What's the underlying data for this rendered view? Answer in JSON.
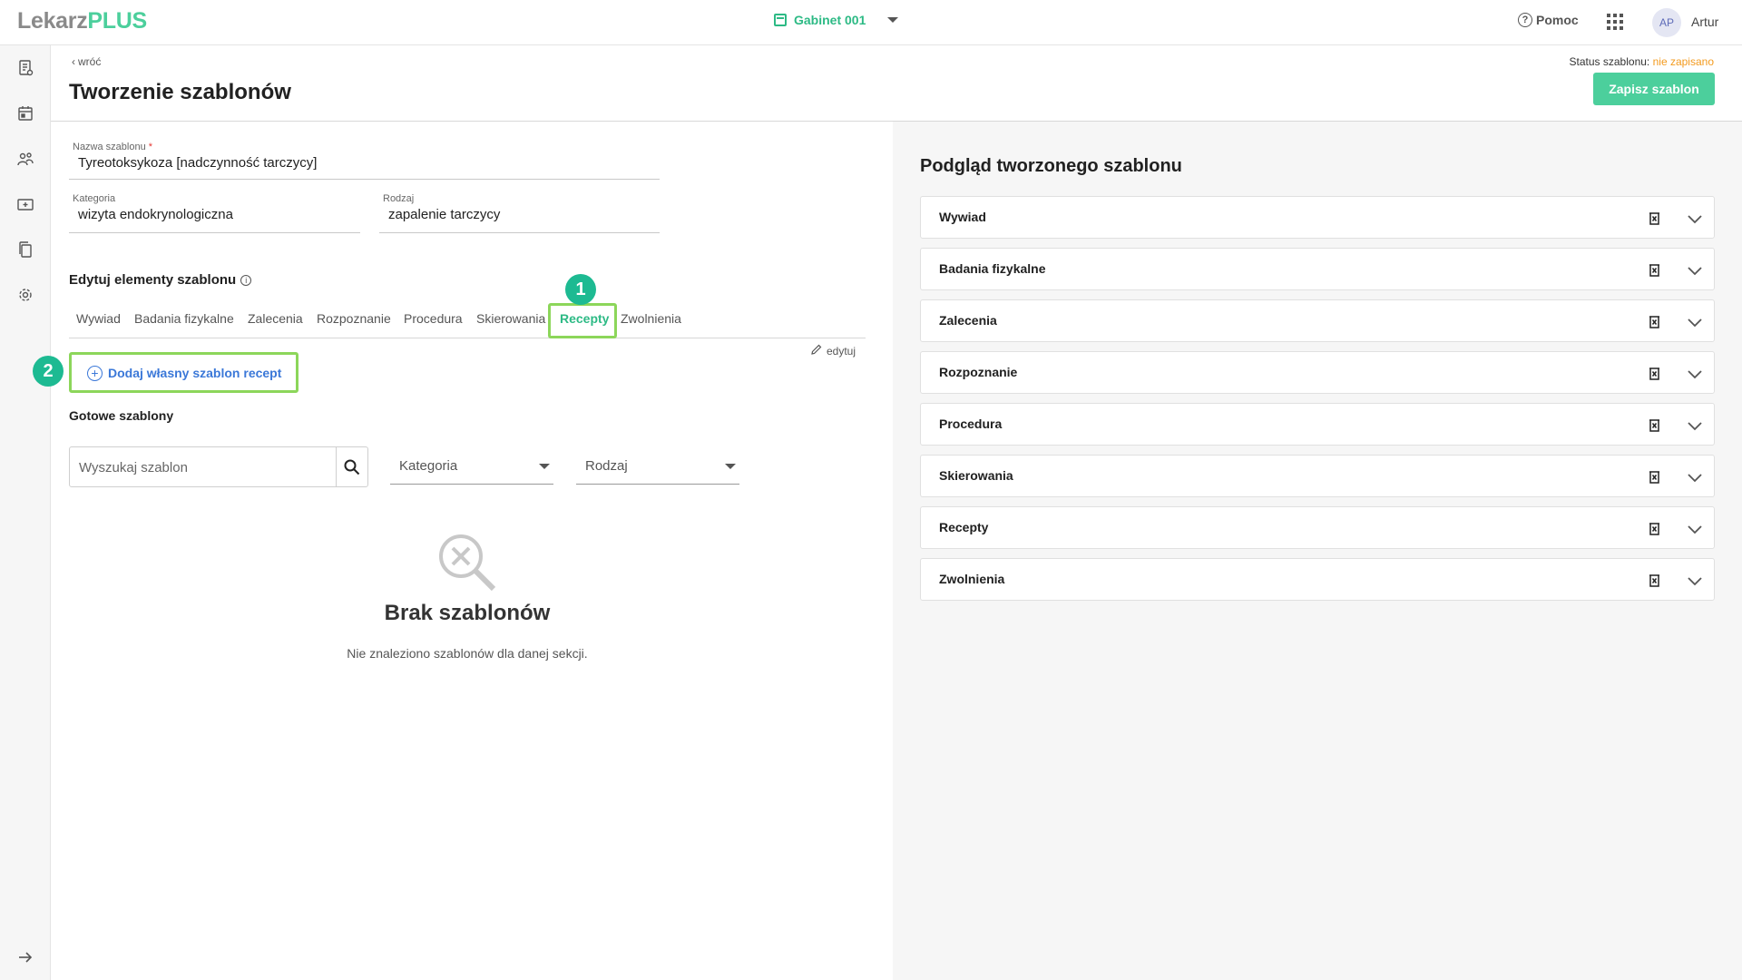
{
  "app": {
    "logo_part1": "Lekarz",
    "logo_part2": "PLUS"
  },
  "topbar": {
    "gabinet": "Gabinet 001",
    "help": "Pomoc",
    "avatar_initials": "AP",
    "username": "Artur"
  },
  "rail": {
    "icons": [
      "document-icon",
      "calendar-icon",
      "patients-icon",
      "medical-case-icon",
      "copy-icon",
      "settings-icon",
      "expand-arrow-icon"
    ]
  },
  "header": {
    "back": "wróć",
    "title": "Tworzenie szablonów",
    "status_label": "Status szablonu:",
    "status_value": "nie zapisano",
    "save_button": "Zapisz szablon"
  },
  "form": {
    "name": {
      "label": "Nazwa szablonu",
      "required_mark": "*",
      "value": "Tyreotoksykoza [nadczynność tarczycy]"
    },
    "category": {
      "label": "Kategoria",
      "value": "wizyta endokrynologiczna"
    },
    "type": {
      "label": "Rodzaj",
      "value": "zapalenie tarczycy"
    }
  },
  "editor": {
    "title": "Edytuj elementy szablonu",
    "info_glyph": "i",
    "tabs": [
      "Wywiad",
      "Badania fizykalne",
      "Zalecenia",
      "Rozpoznanie",
      "Procedura",
      "Skierowania",
      "Recepty",
      "Zwolnienia"
    ],
    "active_tab": "Recepty",
    "edit_link": "edytuj",
    "add_button": "Dodaj własny szablon recept",
    "badges": [
      "1",
      "2"
    ]
  },
  "ready": {
    "title": "Gotowe szablony",
    "search_placeholder": "Wyszukaj szablon",
    "category_select": "Kategoria",
    "type_select": "Rodzaj",
    "empty_title": "Brak szablonów",
    "empty_sub": "Nie znaleziono szablonów dla danej sekcji."
  },
  "preview": {
    "title": "Podgląd tworzonego szablonu",
    "sections": [
      "Wywiad",
      "Badania fizykalne",
      "Zalecenia",
      "Rozpoznanie",
      "Procedura",
      "Skierowania",
      "Recepty",
      "Zwolnienia"
    ]
  },
  "colors": {
    "brand_green": "#4ccf9c",
    "active_tab": "#2dba85",
    "link_blue": "#3b78d8",
    "status_orange": "#f39a1d",
    "highlight": "#8cd65a",
    "badge": "#1dba92"
  }
}
